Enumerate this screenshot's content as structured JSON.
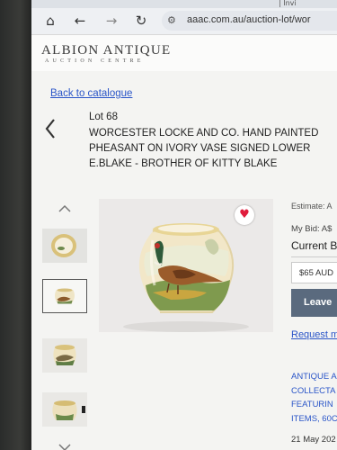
{
  "browser": {
    "tab_text": "| Invi",
    "url": "aaac.com.au/auction-lot/wor",
    "icons": [
      "home-icon",
      "back-arrow-icon",
      "forward-arrow-icon",
      "reload-icon",
      "site-settings-icon"
    ]
  },
  "site": {
    "logo_main": "ALBION ANTIQUE",
    "logo_sub": "AUCTION CENTRE"
  },
  "nav": {
    "back_label": "Back to catalogue"
  },
  "lot": {
    "number_label": "Lot  68",
    "title_lines": [
      "WORCESTER LOCKE AND CO. HAND PAINTED",
      "PHEASANT ON IVORY VASE SIGNED LOWER",
      "E.BLAKE - BROTHER OF KITTY BLAKE"
    ]
  },
  "bidding": {
    "estimate_label": "Estimate: A",
    "my_bid_label": "My Bid: A$",
    "current_label": "Current B",
    "bid_option": "$65 AUD",
    "leave_button": "Leave",
    "request_link": "Request m"
  },
  "catalogue_info": {
    "lines": [
      "ANTIQUE A",
      "COLLECTA",
      "FEATURIN",
      "ITEMS, 60C"
    ],
    "date": "21 May 202"
  },
  "colors": {
    "link": "#2a55c8",
    "favourite": "#e01b3c",
    "button": "#5a6a7e"
  }
}
